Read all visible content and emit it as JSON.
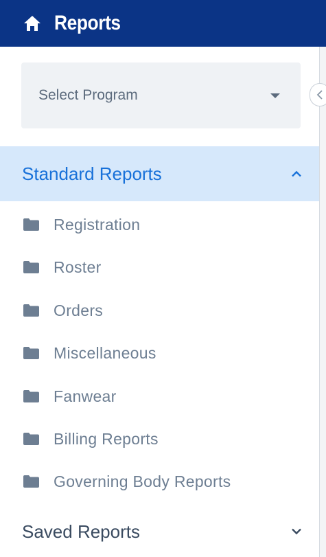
{
  "header": {
    "title": "Reports",
    "icon": "home-icon"
  },
  "program_select": {
    "placeholder": "Select Program"
  },
  "standard_reports": {
    "title": "Standard Reports",
    "expanded": true,
    "items": [
      {
        "label": "Registration"
      },
      {
        "label": "Roster"
      },
      {
        "label": "Orders"
      },
      {
        "label": "Miscellaneous"
      },
      {
        "label": "Fanwear"
      },
      {
        "label": "Billing Reports"
      },
      {
        "label": "Governing Body Reports"
      }
    ]
  },
  "saved_reports": {
    "title": "Saved Reports",
    "expanded": false
  },
  "colors": {
    "header_bg": "#0b3486",
    "section_active_bg": "#d6e8fb",
    "section_active_text": "#1871d9",
    "item_text": "#6d7e92"
  }
}
